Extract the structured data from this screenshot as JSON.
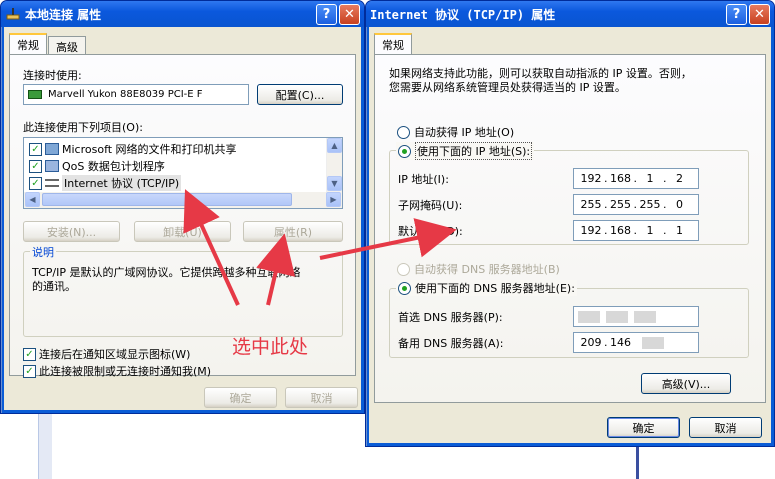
{
  "colors": {
    "title_blue": "#0a5cd6",
    "dialog_bg": "#ece9d8",
    "annotation_red": "#e63946"
  },
  "left_window": {
    "title": "本地连接 属性",
    "tabs": [
      "常规",
      "高级"
    ],
    "connect_using_label": "连接时使用:",
    "adapter_name": "Marvell Yukon 88E8039 PCI-E F",
    "configure_button": "配置(C)...",
    "items_label": "此连接使用下列项目(O):",
    "items": [
      {
        "label": "Microsoft 网络的文件和打印机共享",
        "icon": "share-icon"
      },
      {
        "label": "QoS 数据包计划程序",
        "icon": "qos-icon"
      },
      {
        "label": "Internet 协议 (TCP/IP)",
        "icon": "protocol-icon"
      }
    ],
    "install_button": "安装(N)...",
    "uninstall_button": "卸载(U)",
    "properties_button": "属性(R)",
    "description_title": "说明",
    "description_text_line1": "TCP/IP 是默认的广域网协议。它提供跨越多种互联网络",
    "description_text_line2": "的通讯。",
    "show_icon_label": "连接后在通知区域显示图标(W)",
    "notify_label": "此连接被限制或无连接时通知我(M)",
    "ok_button": "确定",
    "cancel_button": "取消"
  },
  "right_window": {
    "title": "Internet 协议 (TCP/IP) 属性",
    "tab": "常规",
    "intro_line1": "如果网络支持此功能，则可以获取自动指派的 IP 设置。否则，",
    "intro_line2": "您需要从网络系统管理员处获得适当的 IP 设置。",
    "auto_ip_label": "自动获得 IP 地址(O)",
    "manual_ip_label": "使用下面的 IP 地址(S):",
    "ip_label": "IP 地址(I):",
    "ip_value": [
      "192",
      "168",
      "1",
      "2"
    ],
    "mask_label": "子网掩码(U):",
    "mask_value": [
      "255",
      "255",
      "255",
      "0"
    ],
    "gateway_label": "默认网关(D):",
    "gateway_value": [
      "192",
      "168",
      "1",
      "1"
    ],
    "auto_dns_label": "自动获得 DNS 服务器地址(B)",
    "manual_dns_label": "使用下面的 DNS 服务器地址(E):",
    "primary_dns_label": "首选 DNS 服务器(P):",
    "secondary_dns_label": "备用 DNS 服务器(A):",
    "secondary_dns_value": [
      "209",
      "146"
    ],
    "advanced_button": "高级(V)...",
    "ok_button": "确定",
    "cancel_button": "取消"
  },
  "annotation": "选中此处"
}
